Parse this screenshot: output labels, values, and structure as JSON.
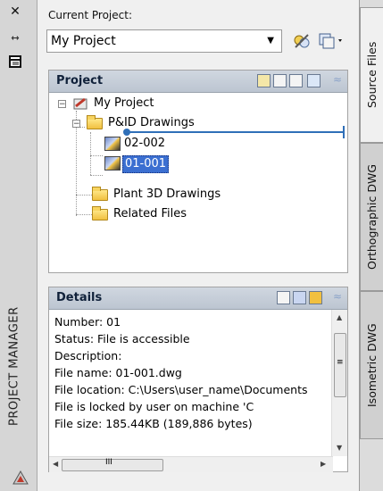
{
  "left_strip": {
    "label": "PROJECT MANAGER",
    "icons": [
      "close-icon",
      "auto-hide-icon",
      "properties-icon",
      "autocad-logo"
    ]
  },
  "header": {
    "current_project_label": "Current Project:",
    "project_value": "My Project"
  },
  "project_panel": {
    "title": "Project",
    "tree": [
      {
        "label": "My Project",
        "icon": "project-icon",
        "level": 0,
        "expanded": true
      },
      {
        "label": "P&ID Drawings",
        "icon": "folder-icon",
        "level": 1,
        "expanded": true
      },
      {
        "label": "02-002",
        "icon": "drawing-icon",
        "level": 2
      },
      {
        "label": "01-001",
        "icon": "drawing-icon",
        "level": 2,
        "selected": true
      },
      {
        "label": "Plant 3D Drawings",
        "icon": "folder-icon",
        "level": 1
      },
      {
        "label": "Related Files",
        "icon": "folder-icon",
        "level": 1
      }
    ]
  },
  "details_panel": {
    "title": "Details",
    "lines": [
      "Number: 01",
      "Status: File is accessible",
      "Description:",
      "File name: 01-001.dwg",
      "File location: C:\\Users\\user_name\\Documents",
      "File is locked by user            on machine 'C",
      "File size: 185.44KB (189,886 bytes)"
    ],
    "hscroll_glyph": "III",
    "vscroll_glyph": "≡"
  },
  "right_tabs": [
    {
      "label": "Source Files",
      "active": true
    },
    {
      "label": "Orthographic DWG",
      "active": false
    },
    {
      "label": "Isometric DWG",
      "active": false
    }
  ],
  "colors": {
    "accent": "#3b6fd1",
    "annotation": "#2f6fb8"
  }
}
